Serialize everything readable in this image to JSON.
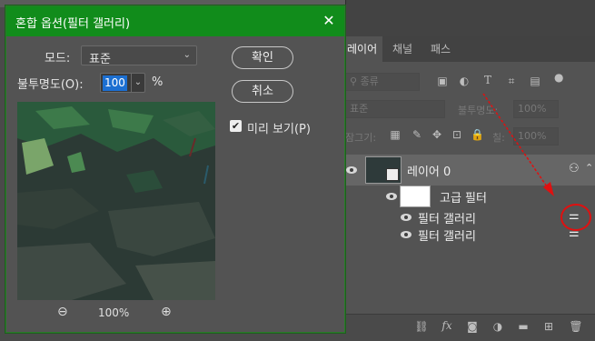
{
  "dialog": {
    "title": "혼합 옵션(필터 갤러리)",
    "mode_label": "모드:",
    "mode_value": "표준",
    "opacity_label": "불투명도(O):",
    "opacity_value": "100",
    "opacity_unit": "%",
    "ok_label": "확인",
    "cancel_label": "취소",
    "preview_label": "미리 보기(P)",
    "preview_checked": true,
    "zoom_value": "100%"
  },
  "layers_panel": {
    "tabs": [
      "레이어",
      "채널",
      "패스"
    ],
    "active_tab": "레이어",
    "filter_kind": "종류",
    "blend_mode": "표준",
    "opacity_label": "불투명도:",
    "opacity_value": "100%",
    "lock_label": "잠그기:",
    "fill_label": "칠:",
    "fill_value": "100%",
    "layer_name": "레이어 0",
    "smart_filters_label": "고급 필터",
    "filter_items": [
      "필터 갤러리",
      "필터 갤러리"
    ]
  },
  "colors": {
    "title_bar": "#118c1b",
    "annotation": "#e01010",
    "selection": "#1c6fd1"
  },
  "icons": {
    "close": "close-icon",
    "zoom_out": "zoom-out-icon",
    "zoom_in": "zoom-in-icon",
    "eye": "eye-icon",
    "blend_options": "blending-options-icon"
  }
}
